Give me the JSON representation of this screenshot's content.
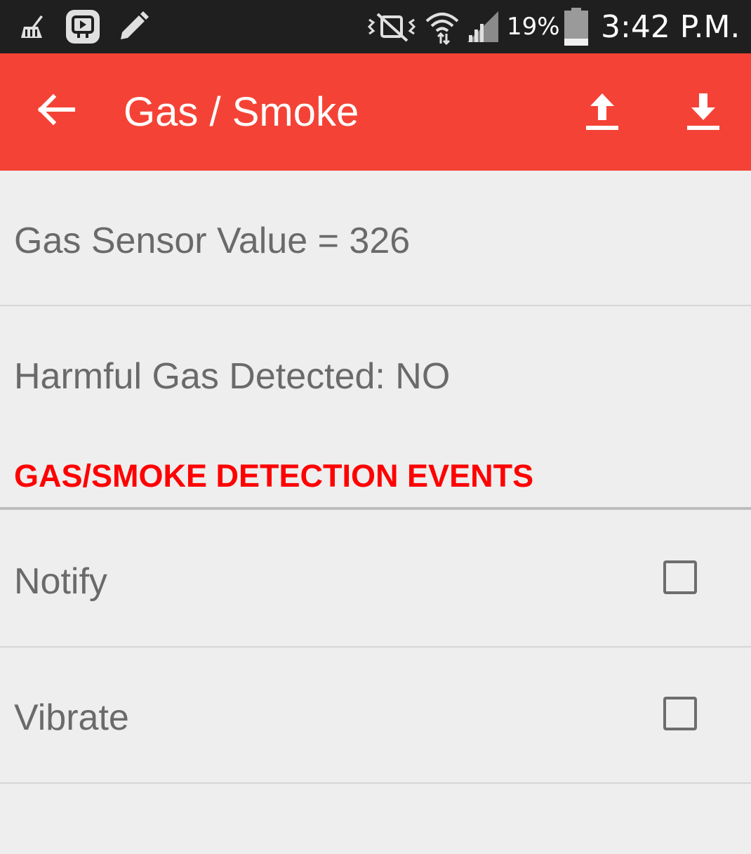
{
  "status_bar": {
    "battery_percent": "19%",
    "time": "3:42 P.M.",
    "icons": [
      "cleaner-icon",
      "app-notification-icon",
      "pencil-icon",
      "vibrate-mute-icon",
      "wifi-icon",
      "signal-icon",
      "battery-icon"
    ]
  },
  "app_bar": {
    "title": "Gas / Smoke",
    "back_icon": "arrow-back-icon",
    "actions": [
      "upload-icon",
      "download-icon"
    ],
    "color": "#f44336"
  },
  "readings": {
    "sensor_value": "Gas Sensor Value = 326",
    "harmful_status": "Harmful Gas Detected: NO"
  },
  "section": {
    "title": "GAS/SMOKE DETECTION EVENTS",
    "color": "#ff0000"
  },
  "settings": [
    {
      "label": "Notify",
      "checked": false
    },
    {
      "label": "Vibrate",
      "checked": false
    }
  ]
}
